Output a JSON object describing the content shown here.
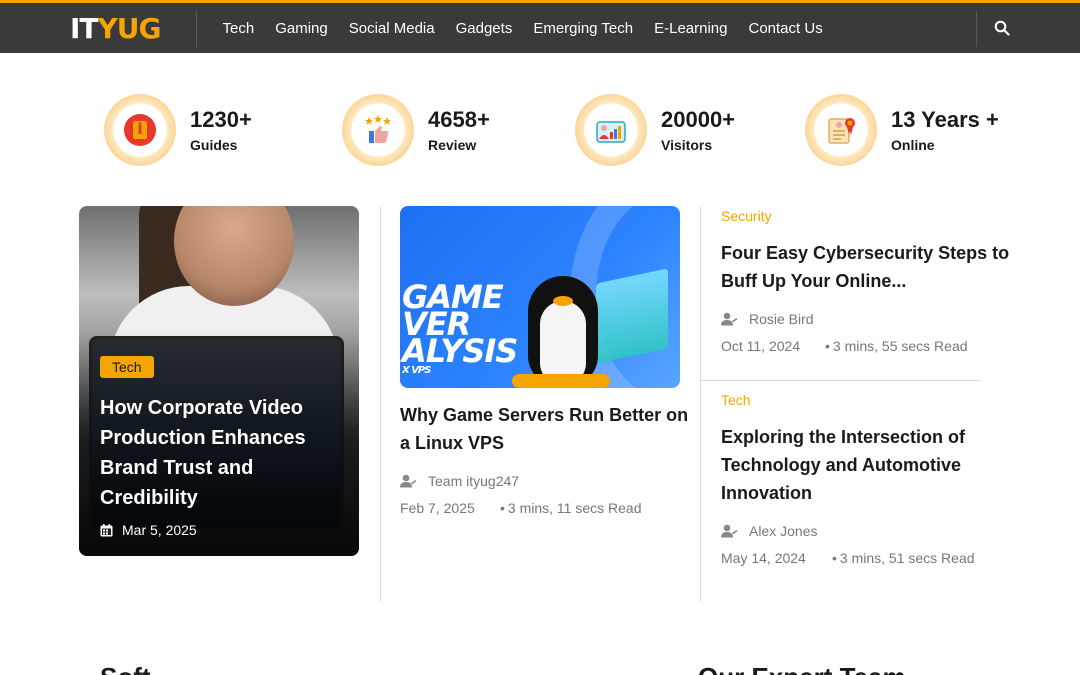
{
  "header": {
    "logo": {
      "part1": "IT",
      "part2": "YUG"
    },
    "nav": [
      "Tech",
      "Gaming",
      "Social Media",
      "Gadgets",
      "Emerging Tech",
      "E-Learning",
      "Contact Us"
    ],
    "search_icon": "search-icon"
  },
  "stats": [
    {
      "number": "1230+",
      "label": "Guides",
      "icon": "book-icon"
    },
    {
      "number": "4658+",
      "label": "Review",
      "icon": "thumbs-up-stars-icon"
    },
    {
      "number": "20000+",
      "label": "Visitors",
      "icon": "analytics-user-icon"
    },
    {
      "number": "13 Years +",
      "label": "Online",
      "icon": "certificate-icon"
    }
  ],
  "featured": {
    "category": "Tech",
    "title": "How Corporate Video Production Enhances Brand Trust and Credibility",
    "date": "Mar 5, 2025"
  },
  "middle": {
    "image_text": {
      "line1": "GAME",
      "line2": "VER",
      "line3": "ALYSIS",
      "line4": "X VPS"
    },
    "title": "Why Game Servers Run Better on a Linux VPS",
    "author": "Team ityug247",
    "date": "Feb 7, 2025",
    "read_time": "3 mins, 11 secs Read"
  },
  "side_posts": [
    {
      "category": "Security",
      "title": "Four Easy Cybersecurity Steps to Buff Up Your Online...",
      "author": "Rosie Bird",
      "date": "Oct 11, 2024",
      "read_time": "3 mins, 55 secs Read"
    },
    {
      "category": "Tech",
      "title": "Exploring the Intersection of Technology and Automotive Innovation",
      "author": "Alex Jones",
      "date": "May 14, 2024",
      "read_time": "3 mins, 51 secs Read"
    }
  ],
  "bottom": {
    "left_heading": "Soft",
    "right_heading": "Our Expert Team"
  },
  "colors": {
    "accent": "#f5a400",
    "header_bg": "#3a3a3a"
  }
}
